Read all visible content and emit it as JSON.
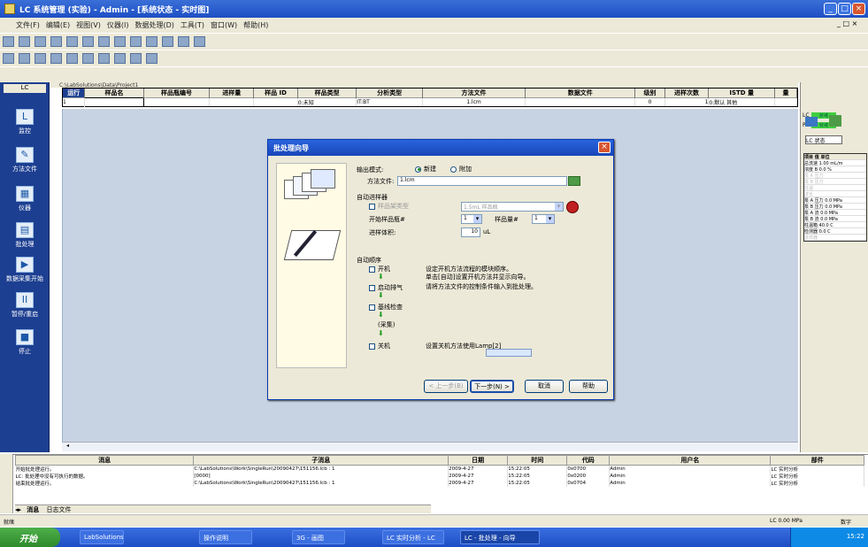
{
  "window": {
    "title": "LC 系统管理 (实验) - Admin - [系统状态 - 实时图]",
    "min": "_",
    "max": "□",
    "close": "×",
    "mdi_controls": "_ □ ×"
  },
  "menu": [
    "文件(F)",
    "编辑(E)",
    "视图(V)",
    "仪器(I)",
    "数据处理(D)",
    "工具(T)",
    "窗口(W)",
    "帮助(H)"
  ],
  "left_nav": [
    {
      "label": "监控",
      "icon": "monitor-icon"
    },
    {
      "label": "方法文件",
      "icon": "method-file-icon"
    },
    {
      "label": "仪器",
      "icon": "instrument-icon"
    },
    {
      "label": "批处理",
      "icon": "batch-icon"
    },
    {
      "label": "数据采集开始",
      "icon": "start-acquisition-icon"
    },
    {
      "label": "暂停/重启",
      "icon": "pause-icon"
    },
    {
      "label": "停止",
      "icon": "stop-icon"
    }
  ],
  "seq_path": "C:\\LabSolutions\\Data\\Project1",
  "seq_table": {
    "headers": [
      "运行",
      "样品名",
      "样品瓶编号",
      "进样量",
      "样品 ID",
      "样品类型",
      "分析类型",
      "方法文件",
      "数据文件",
      "级别",
      "进样次数",
      "ISTD 量",
      "量"
    ],
    "row": [
      "1",
      "",
      "",
      "",
      "",
      "0:未知",
      "IT:BT",
      "1.lcm",
      "",
      "0",
      "1",
      "0:默认 其他",
      ""
    ]
  },
  "right_panel": {
    "stats": [
      {
        "label": "LC",
        "value": "就绪"
      },
      {
        "label": "PDA",
        "value": "就绪"
      }
    ],
    "monitor_title": "LC 状态",
    "monitor_head": [
      "项目",
      "值",
      "单位"
    ],
    "monitor_rows": [
      "总流速 1.00 mL/m",
      "浓度 B 0.0 %",
      "泵 A 压力",
      "泵 B 压力",
      "柱温",
      "波长",
      "泵 A 压力 0.0 MPa",
      "泵 B 压力 0.0 MPa",
      "泵 A 流 0.0 MPa",
      "泵 B 流 0.0 MPa",
      "柱温箱 40.0 C",
      "检测器 0.0 C",
      "进样器"
    ]
  },
  "dialog": {
    "title": "批处理向导",
    "output_label": "输出模式:",
    "radio_new": "新建",
    "radio_append": "附加",
    "method_label": "方法文件:",
    "method_value": "1.lcm",
    "auto_fill_label": "自动进样器",
    "type_label": "样品架类型",
    "type_value": "1.5mL 样品瓶",
    "start_label": "开始样品瓶#",
    "start_value": "1",
    "vol_label": "样品量#",
    "vol_value": "1",
    "inj_label": "进样体积:",
    "inj_value": "10",
    "inj_unit": "uL",
    "seq_label": "自动顺序",
    "steps": [
      "开机",
      "启动排气",
      "基线检查",
      "关机"
    ],
    "step_extra": "(采集)",
    "note1": "设定开机方法流程的模块顺序。",
    "note2": "单击[自动]设置开机方法并显示向导。",
    "note3": "请将方法文件的控制条件输入到批处理。",
    "note4": "设置关机方法使用Lamp[2]",
    "btn_back": "< 上一步(B)",
    "btn_next": "下一步(N) >",
    "btn_cancel": "取消",
    "btn_help": "帮助"
  },
  "log": {
    "headers": [
      "消息",
      "子消息",
      "日期",
      "时间",
      "代码",
      "用户名",
      "部件"
    ],
    "rows": [
      [
        "开始批处理运行。",
        "C:\\LabSolutions\\Work\\SingleRun\\20090427\\151156.lcb : 1",
        "2009-4-27",
        "15:22:05",
        "0x0700",
        "Admin",
        "LC 实时分析"
      ],
      [
        "LC: 批处理中没有可执行的数据。",
        "[0000]",
        "2009-4-27",
        "15:22:05",
        "0x0200",
        "Admin",
        "LC 实时分析"
      ],
      [
        "结束批处理运行。",
        "C:\\LabSolutions\\Work\\SingleRun\\20090427\\151156.lcb : 1",
        "2009-4-27",
        "15:22:05",
        "0x0704",
        "Admin",
        "LC 实时分析"
      ]
    ],
    "tab_messages": "消息",
    "tab_logfile": "日志文件"
  },
  "status": {
    "left": "就绪",
    "right1": "LC 0.00 MPa",
    "right2": "数字"
  },
  "taskbar": {
    "start": "开始",
    "tasks": [
      "LabSolutions",
      "操作说明",
      "3G - 画图",
      "LC 实时分析 - LC",
      "LC - 批处理 - 向导"
    ],
    "clock": "15:22"
  }
}
